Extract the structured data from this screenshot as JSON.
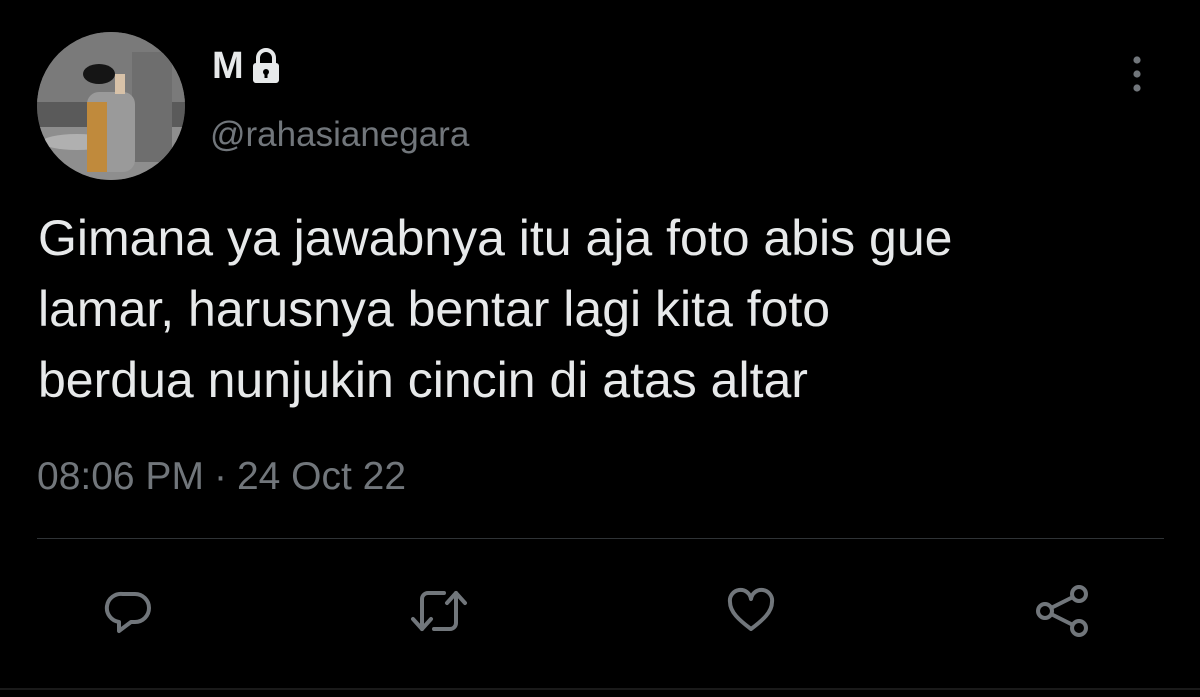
{
  "tweet": {
    "display_name": "M",
    "handle": "@rahasianegara",
    "text": "Gimana ya jawabnya itu aja foto abis gue\nlamar, harusnya bentar lagi kita foto\nberdua nunjukin cincin di atas altar",
    "time": "08:06 PM",
    "separator": "·",
    "date": "24 Oct 22",
    "protected": true
  },
  "icons": {
    "lock": "lock-icon",
    "more": "more-vertical-icon",
    "reply": "reply-icon",
    "retweet": "retweet-icon",
    "like": "heart-icon",
    "share": "share-icon"
  },
  "colors": {
    "background": "#000000",
    "text_primary": "#e7e9ea",
    "text_secondary": "#71767b",
    "divider": "#2f3336"
  }
}
